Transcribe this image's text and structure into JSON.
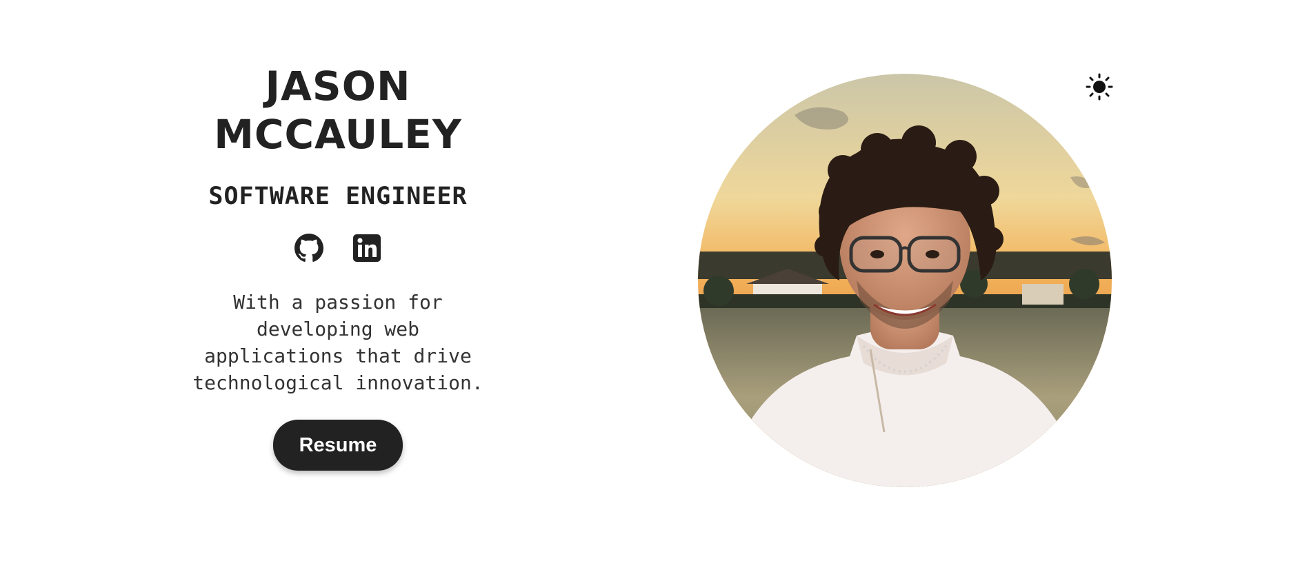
{
  "hero": {
    "name_line1": "JASON",
    "name_line2": "MCCAULEY",
    "role": "SOFTWARE ENGINEER",
    "bio": "With a passion for developing web applications that drive technological innovation.",
    "resume_label": "Resume"
  },
  "socials": [
    {
      "icon": "github-icon"
    },
    {
      "icon": "linkedin-icon"
    }
  ],
  "theme_toggle": {
    "icon": "sun-icon"
  },
  "colors": {
    "text": "#222222",
    "button_bg": "#222222",
    "button_text": "#ffffff",
    "background": "#ffffff"
  }
}
